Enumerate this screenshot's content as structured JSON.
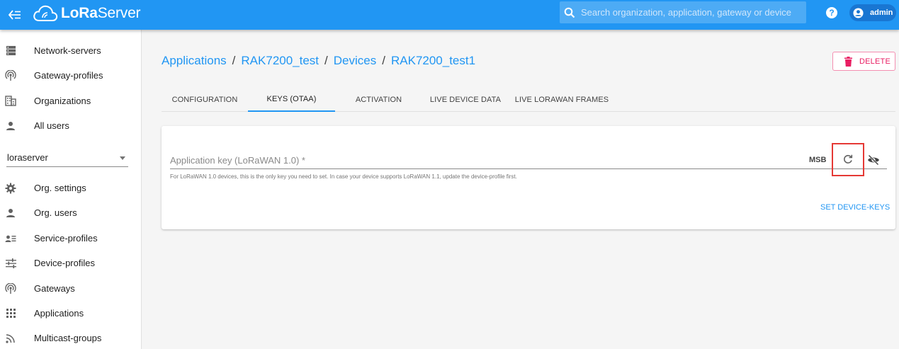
{
  "topbar": {
    "logo_prefix": "LoRa",
    "logo_suffix": "Server",
    "search_placeholder": "Search organization, application, gateway or device",
    "user": "admin"
  },
  "sidebar": {
    "global_items": [
      {
        "label": "Network-servers",
        "icon": "server-icon"
      },
      {
        "label": "Gateway-profiles",
        "icon": "broadcast-icon"
      },
      {
        "label": "Organizations",
        "icon": "building-icon"
      },
      {
        "label": "All users",
        "icon": "person-icon"
      }
    ],
    "org_select": "loraserver",
    "org_items": [
      {
        "label": "Org. settings",
        "icon": "gear-icon"
      },
      {
        "label": "Org. users",
        "icon": "person-icon"
      },
      {
        "label": "Service-profiles",
        "icon": "account-details-icon"
      },
      {
        "label": "Device-profiles",
        "icon": "tune-icon"
      },
      {
        "label": "Gateways",
        "icon": "broadcast-icon"
      },
      {
        "label": "Applications",
        "icon": "apps-grid-icon"
      },
      {
        "label": "Multicast-groups",
        "icon": "rss-icon"
      }
    ]
  },
  "breadcrumb": [
    "Applications",
    "RAK7200_test",
    "Devices",
    "RAK7200_test1"
  ],
  "delete_label": "DELETE",
  "tabs": [
    "CONFIGURATION",
    "KEYS (OTAA)",
    "ACTIVATION",
    "LIVE DEVICE DATA",
    "LIVE LORAWAN FRAMES"
  ],
  "active_tab": "KEYS (OTAA)",
  "keys_form": {
    "field_label": "Application key (LoRaWAN 1.0) *",
    "field_value": "",
    "byte_order": "MSB",
    "helper_text": "For LoRaWAN 1.0 devices, this is the only key you need to set. In case your device supports LoRaWAN 1.1, update the device-profile first.",
    "submit_label": "SET DEVICE-KEYS"
  },
  "colors": {
    "primary": "#2196f3",
    "danger": "#e91e63",
    "highlight": "#e53935"
  }
}
